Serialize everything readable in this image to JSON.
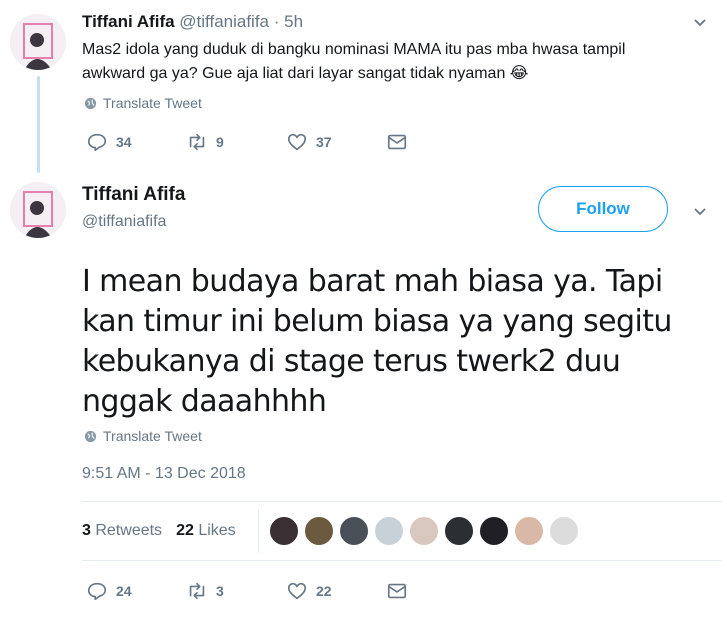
{
  "reply_tweet": {
    "name": "Tiffani Afifa",
    "handle": "@tiffaniafifa",
    "separator": "·",
    "time": "5h",
    "text": "Mas2 idola yang duduk di bangku nominasi MAMA itu pas mba hwasa tampil awkward ga ya? Gue aja liat dari layar sangat tidak nyaman 😂",
    "translate_label": "Translate Tweet",
    "actions": {
      "replies": "34",
      "retweets": "9",
      "likes": "37"
    }
  },
  "focal_tweet": {
    "name": "Tiffani Afifa",
    "handle": "@tiffaniafifa",
    "follow_label": "Follow",
    "text": "I mean budaya barat mah biasa ya. Tapi kan timur ini belum biasa ya yang segitu kebukanya di stage terus twerk2 duu nggak daaahhhh",
    "translate_label": "Translate Tweet",
    "timestamp": "9:51 AM - 13 Dec 2018",
    "stats": {
      "retweets_count": "3",
      "retweets_label": "Retweets",
      "likes_count": "22",
      "likes_label": "Likes"
    },
    "liker_colors": [
      "#3a3033",
      "#6b5a40",
      "#4a5058",
      "#c9d1d8",
      "#d8c8c0",
      "#2b2f33",
      "#1f1f25",
      "#d9b8a8",
      "#dcdcdc"
    ],
    "actions": {
      "replies": "24",
      "retweets": "3",
      "likes": "22"
    }
  },
  "colors": {
    "accent": "#1da1f2",
    "secondary_text": "#657786",
    "primary_text": "#14171a",
    "thread_line": "#c4dff6"
  }
}
